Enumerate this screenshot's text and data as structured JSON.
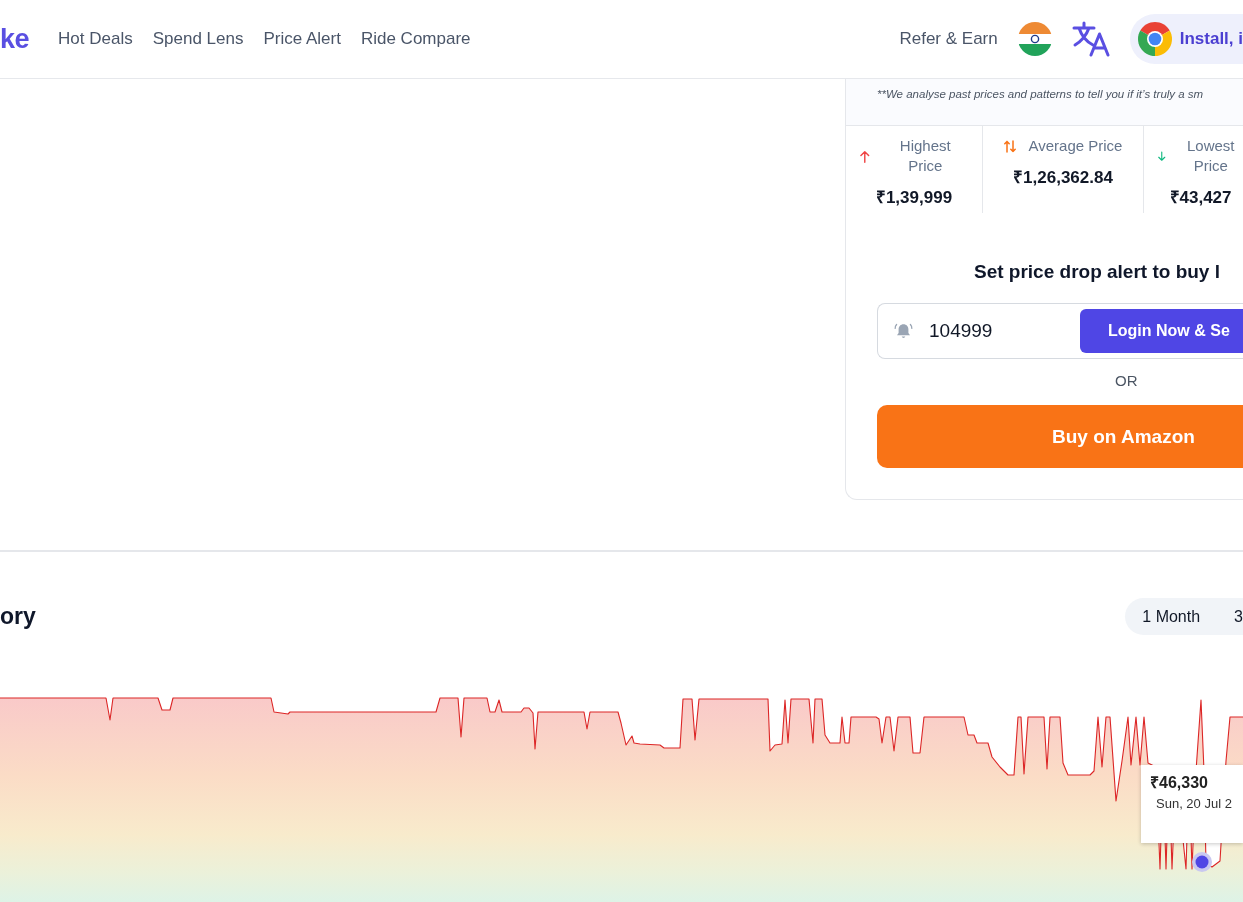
{
  "header": {
    "logo": "ke",
    "nav": [
      "Hot Deals",
      "Spend Lens",
      "Price Alert",
      "Ride Compare"
    ],
    "refer_link": "Refer & Earn",
    "install_button": "Install, i"
  },
  "price_panel": {
    "note": "**We analyse past prices and patterns to tell you if it’s truly a sm",
    "stats": [
      {
        "kind": "highest",
        "label": "Highest Price",
        "value": "₹1,39,999"
      },
      {
        "kind": "average",
        "label": "Average Price",
        "value": "₹1,26,362.84"
      },
      {
        "kind": "lowest",
        "label": "Lowest Price",
        "value": "₹43,427"
      }
    ],
    "alert": {
      "heading": "Set price drop alert to buy l",
      "input_value": "104999",
      "login_button": "Login Now & Se"
    },
    "separator": "OR",
    "buy_button": "Buy on Amazon"
  },
  "price_history": {
    "title": "ory",
    "ranges": [
      {
        "label": "1 Month",
        "selected": false
      },
      {
        "label": "3",
        "selected": false
      }
    ],
    "tooltip": {
      "price": "₹46,330",
      "date": "Sun, 20 Jul 2"
    }
  }
}
